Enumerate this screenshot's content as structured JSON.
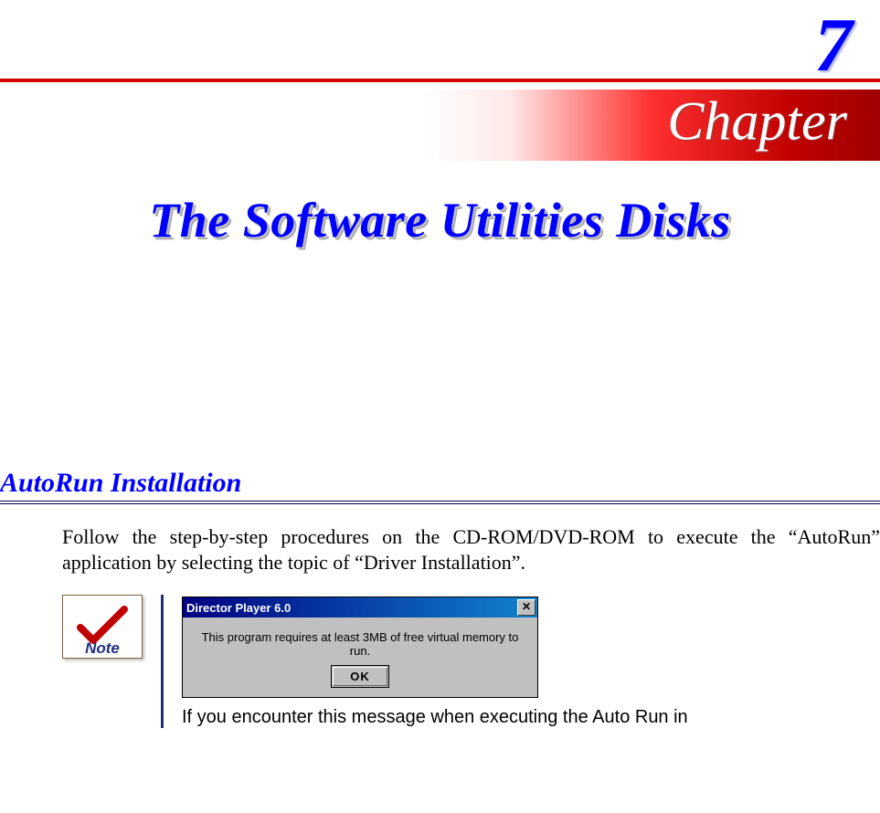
{
  "chapter": {
    "number": "7",
    "label": "Chapter",
    "title": "The Software Utilities Disks"
  },
  "section": {
    "heading": "AutoRun Installation",
    "body": "Follow the step-by-step procedures on the CD-ROM/DVD-ROM to execute the “AutoRun” application by selecting the topic of “Driver Installation”."
  },
  "note": {
    "icon_label": "Note",
    "dialog": {
      "title": "Director Player 6.0",
      "message": "This program requires at least 3MB of free virtual memory to run.",
      "ok_label": "OK",
      "close_glyph": "✕"
    },
    "caption": "If you encounter this message when executing the Auto Run  in"
  }
}
